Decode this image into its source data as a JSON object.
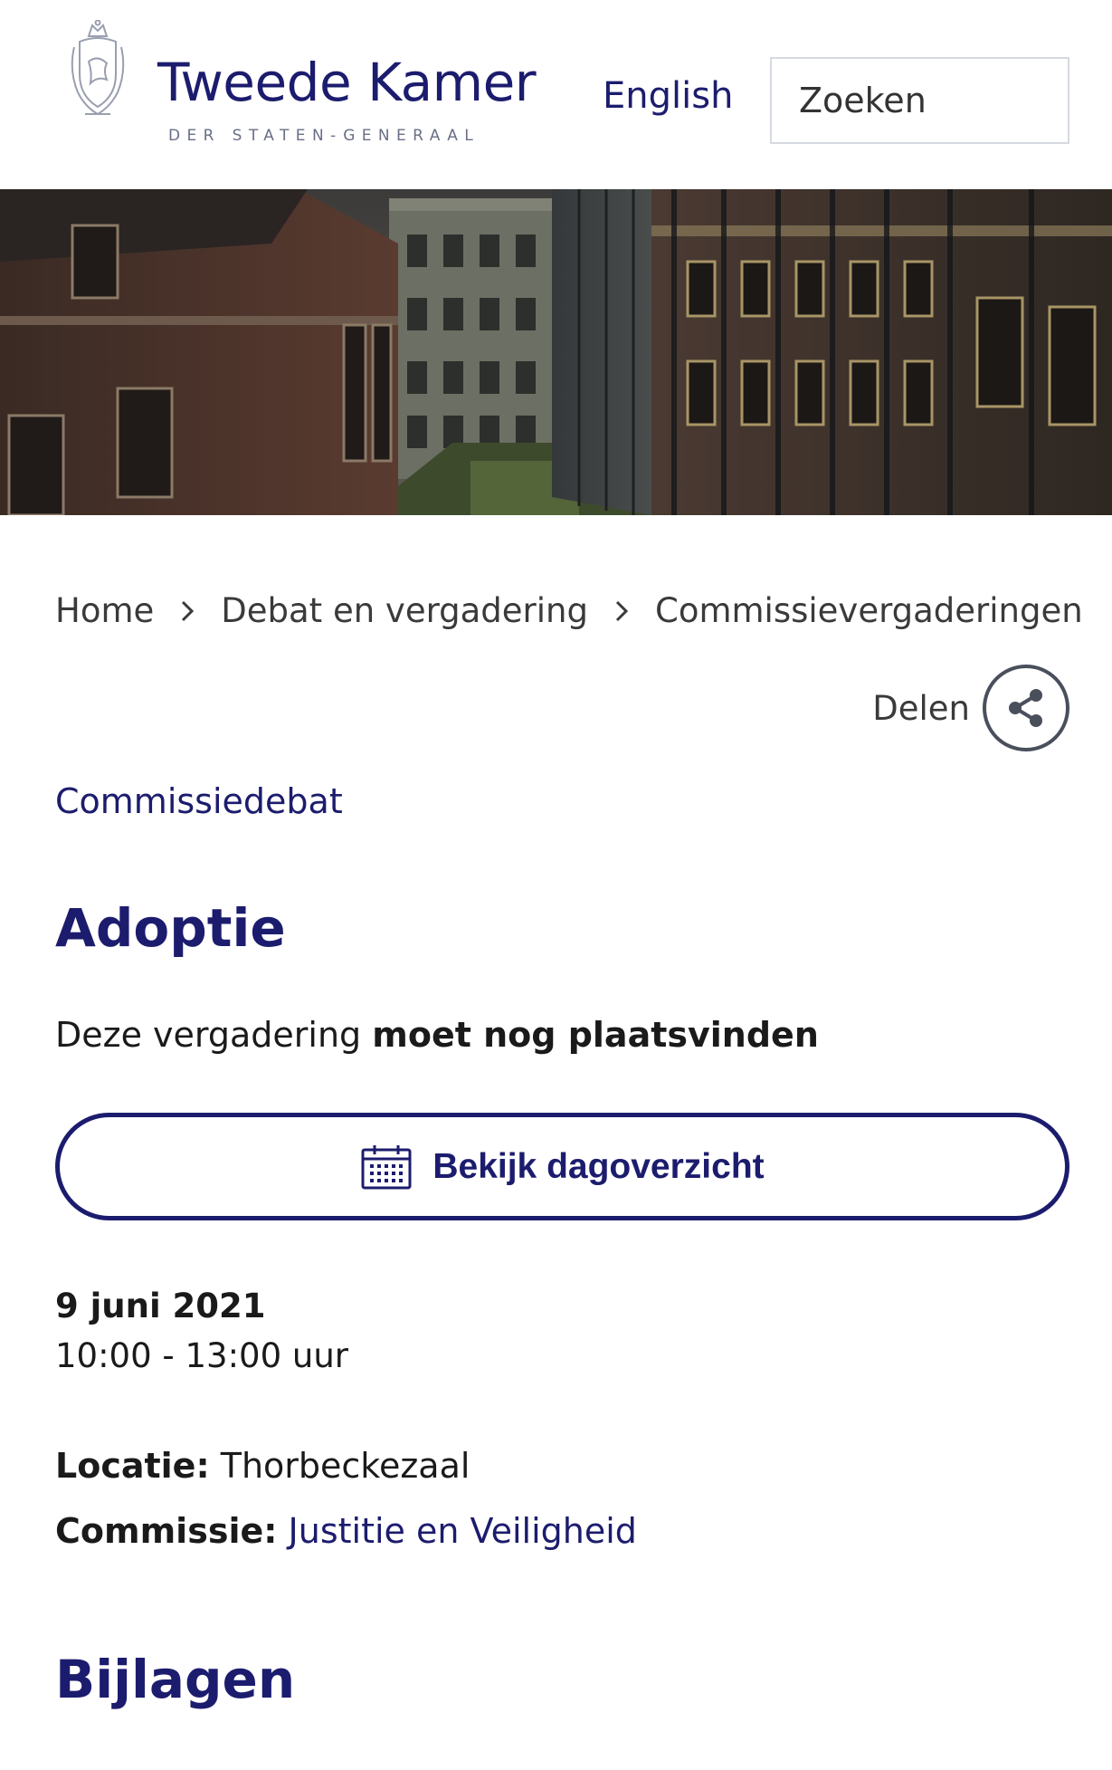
{
  "header": {
    "logo_title": "Tweede Kamer",
    "logo_subtitle": "DER STATEN-GENERAAL",
    "language_link": "English",
    "search_placeholder": "Zoeken"
  },
  "breadcrumb": {
    "items": [
      "Home",
      "Debat en vergadering",
      "Commissievergaderingen"
    ]
  },
  "share": {
    "label": "Delen"
  },
  "meeting": {
    "type": "Commissiedebat",
    "title": "Adoptie",
    "status_prefix": "Deze vergadering ",
    "status_emphasis": "moet nog plaatsvinden",
    "day_overview_button": "Bekijk dagoverzicht",
    "date": "9 juni 2021",
    "time": "10:00 - 13:00 uur",
    "location_label": "Locatie:",
    "location_value": "Thorbeckezaal",
    "committee_label": "Commissie:",
    "committee_value": "Justitie en Veiligheid"
  },
  "sections": {
    "attachments_title": "Bijlagen"
  },
  "colors": {
    "brand": "#1c1c6e",
    "text": "#1a1a1a",
    "muted": "#3a3a3a"
  }
}
